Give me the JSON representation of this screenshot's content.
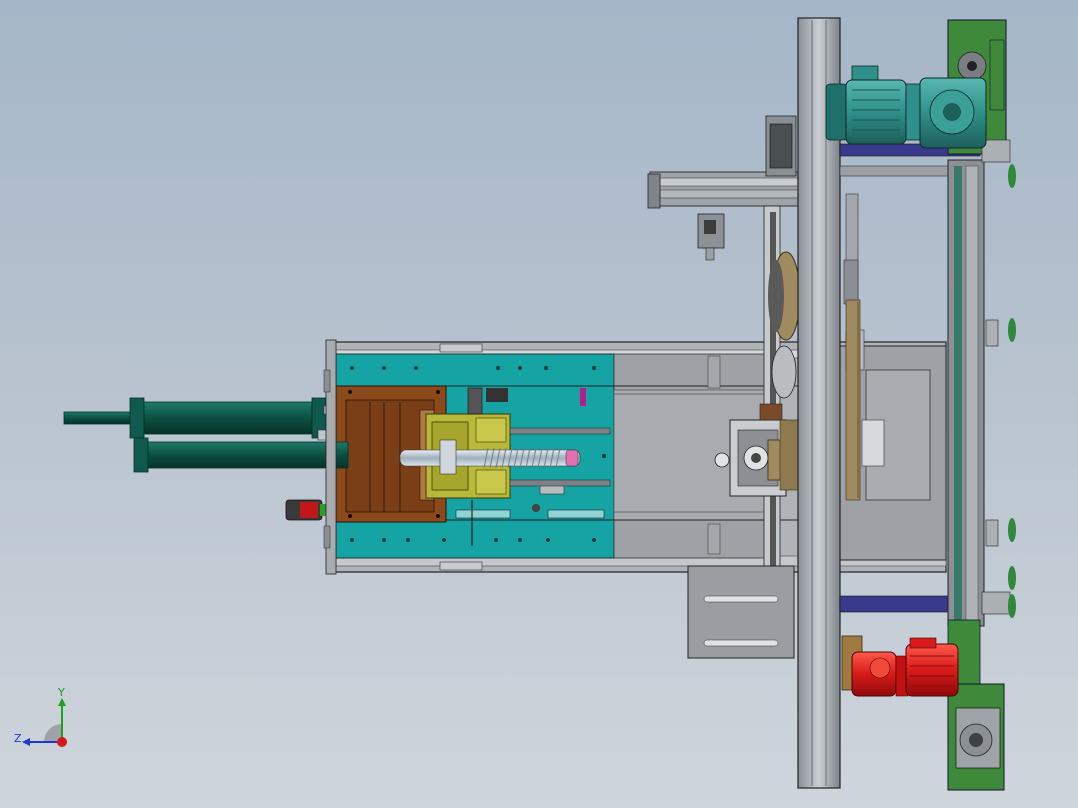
{
  "triad": {
    "y_label": "Y",
    "z_label": "Z"
  },
  "colors": {
    "background_top": "#a4b6c8",
    "background_bottom": "#cfd5dc",
    "frame_gray": "#8e9296",
    "teal_plate": "#15a3a3",
    "brown_block": "#8a4a1c",
    "olive_slide": "#b8b83a",
    "green_cylinder": "#0f5a4c",
    "motor_teal": "#2f8f8a",
    "motor_red": "#d81a1a",
    "navy_bar": "#3a3a8c",
    "green_plate": "#3e8a3a",
    "tan_part": "#a08a60"
  }
}
